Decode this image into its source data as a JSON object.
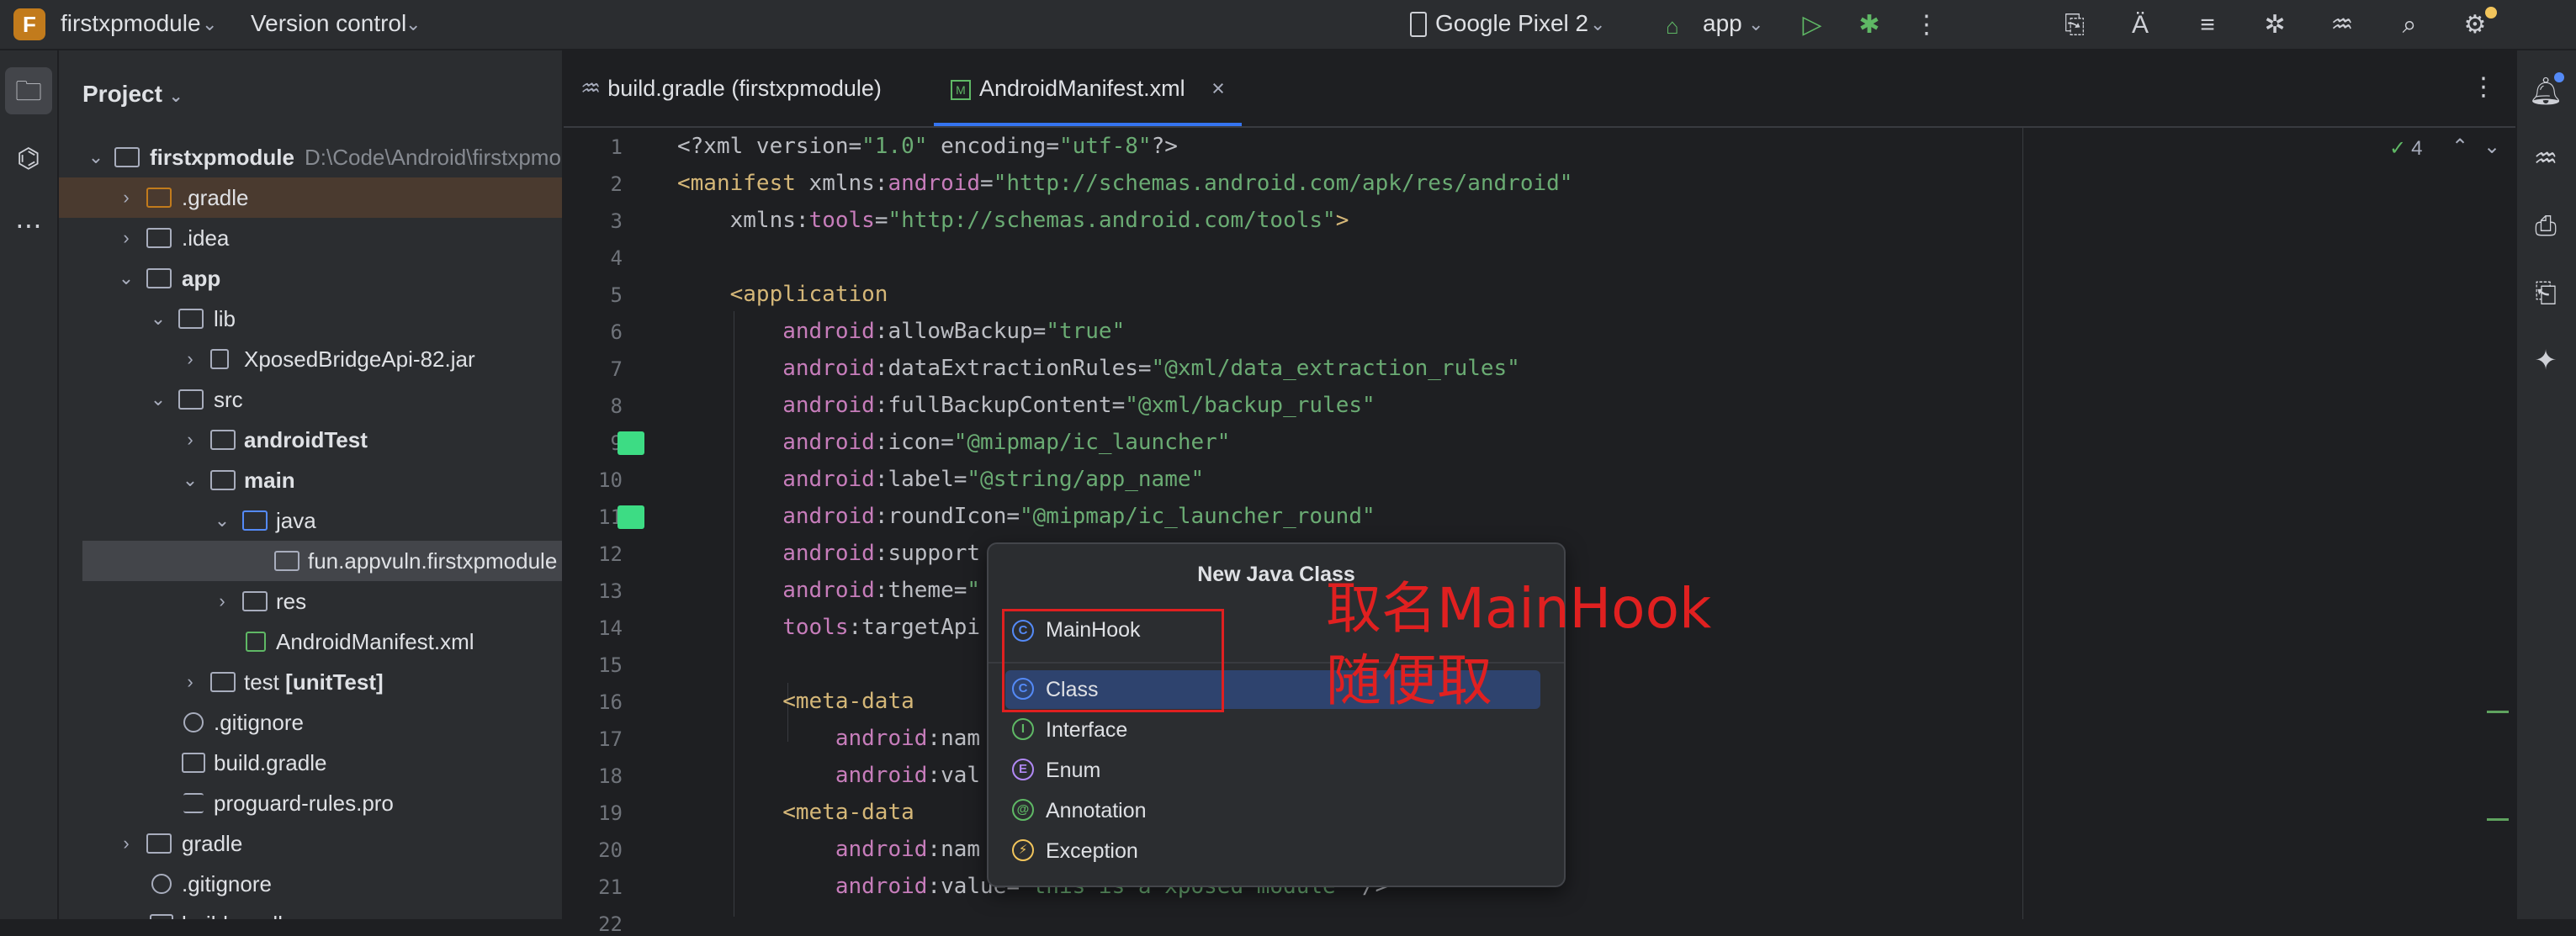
{
  "titlebar": {
    "project_badge": "F",
    "project_name": "firstxpmodule",
    "vcs": "Version control",
    "device": "Google Pixel 2",
    "run_config": "app"
  },
  "project_panel": {
    "title": "Project",
    "tree": [
      {
        "label": "firstxpmodule",
        "path": "D:\\Code\\Android\\firstxpmo",
        "bold": true
      },
      {
        "label": ".gradle"
      },
      {
        "label": ".idea"
      },
      {
        "label": "app",
        "bold": true
      },
      {
        "label": "lib"
      },
      {
        "label": "XposedBridgeApi-82.jar"
      },
      {
        "label": "src"
      },
      {
        "label": "androidTest",
        "bold": true
      },
      {
        "label": "main",
        "bold": true
      },
      {
        "label": "java"
      },
      {
        "label": "fun.appvuln.firstxpmodule"
      },
      {
        "label": "res"
      },
      {
        "label": "AndroidManifest.xml"
      },
      {
        "label": "test",
        "suffix": "[unitTest]"
      },
      {
        "label": ".gitignore"
      },
      {
        "label": "build.gradle"
      },
      {
        "label": "proguard-rules.pro"
      },
      {
        "label": "gradle"
      },
      {
        "label": ".gitignore"
      },
      {
        "label": "build.gradle"
      }
    ]
  },
  "editor": {
    "tabs": [
      {
        "label": "build.gradle (firstxpmodule)"
      },
      {
        "label": "AndroidManifest.xml",
        "active": true
      }
    ],
    "inspection_count": "4",
    "line_numbers": [
      "1",
      "2",
      "3",
      "4",
      "5",
      "6",
      "7",
      "8",
      "9",
      "10",
      "11",
      "12",
      "13",
      "14",
      "15",
      "16",
      "17",
      "18",
      "19",
      "20",
      "21",
      "22"
    ],
    "code": {
      "l1a": "<?xml version=",
      "l1b": "\"1.0\"",
      "l1c": " encoding=",
      "l1d": "\"utf-8\"",
      "l1e": "?>",
      "l2a": "<manifest",
      "l2b": " xmlns:",
      "l2c": "android",
      "l2d": "=",
      "l2e": "\"http://schemas.android.com/apk/res/android\"",
      "l3a": "    xmlns:",
      "l3b": "tools",
      "l3c": "=",
      "l3d": "\"http://schemas.android.com/tools\"",
      "l3e": ">",
      "l5": "    <application",
      "l6a": "        android",
      "l6b": ":allowBackup=",
      "l6c": "\"true\"",
      "l7a": "        android",
      "l7b": ":dataExtractionRules=",
      "l7c": "\"@xml/data_extraction_rules\"",
      "l8a": "        android",
      "l8b": ":fullBackupContent=",
      "l8c": "\"@xml/backup_rules\"",
      "l9a": "        android",
      "l9b": ":icon=",
      "l9c": "\"@mipmap/ic_launcher\"",
      "l10a": "        android",
      "l10b": ":label=",
      "l10c": "\"@string/app_name\"",
      "l11a": "        android",
      "l11b": ":roundIcon=",
      "l11c": "\"@mipmap/ic_launcher_round\"",
      "l12a": "        android",
      "l12b": ":support",
      "l13a": "        android",
      "l13b": ":theme=",
      "l13c": "\"",
      "l14a": "        tools",
      "l14b": ":targetApi",
      "l16": "        <meta-data",
      "l17a": "            android",
      "l17b": ":nam",
      "l18a": "            android",
      "l18b": ":val",
      "l19": "        <meta-data",
      "l20a": "            android",
      "l20b": ":nam",
      "l21a": "            android",
      "l21b": ":value=",
      "l21c": "\"this is a xposed module\"",
      "l21d": " />"
    }
  },
  "popup": {
    "title": "New Java Class",
    "input_value": "MainHook",
    "items": [
      {
        "label": "Class",
        "icon": "C",
        "color": "#548af7"
      },
      {
        "label": "Interface",
        "icon": "I",
        "color": "#5fb865"
      },
      {
        "label": "Enum",
        "icon": "E",
        "color": "#b189f5"
      },
      {
        "label": "Annotation",
        "icon": "@",
        "color": "#5fb865"
      },
      {
        "label": "Exception",
        "icon": "⚡",
        "color": "#f2c55c"
      }
    ]
  },
  "annotation": {
    "line1": "取名MainHook",
    "line2": "随便取"
  }
}
